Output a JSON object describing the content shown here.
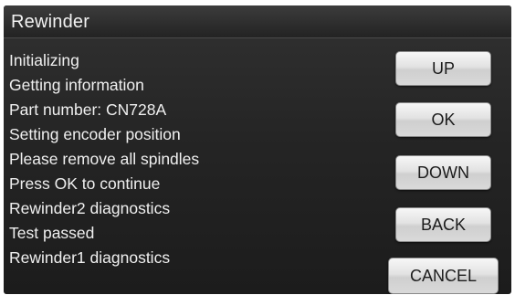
{
  "window": {
    "title": "Rewinder"
  },
  "messages": [
    "Initializing",
    "Getting information",
    "Part number: CN728A",
    "Setting encoder position",
    "Please remove all spindles",
    "Press OK to continue",
    "Rewinder2 diagnostics",
    "Test passed",
    "Rewinder1 diagnostics"
  ],
  "buttons": {
    "up": "UP",
    "ok": "OK",
    "down": "DOWN",
    "back": "BACK",
    "cancel": "CANCEL"
  },
  "colors": {
    "panel_background": "#252525",
    "text": "#f0f0f0",
    "button_face": "#e2e2e2",
    "button_text": "#1c1c1c"
  }
}
